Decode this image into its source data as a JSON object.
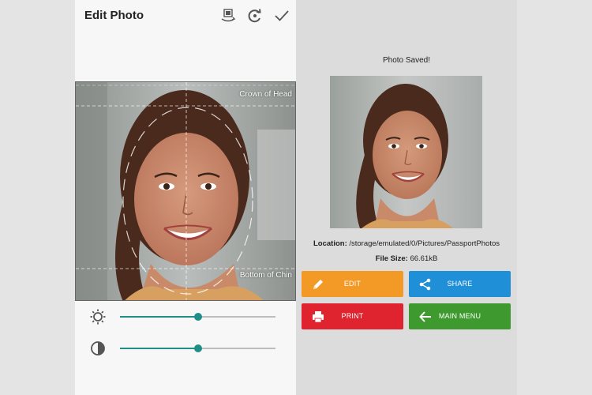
{
  "edit_screen": {
    "title": "Edit Photo",
    "toolbar_icons": [
      "crop-rotate-icon",
      "reset-icon",
      "check-icon"
    ],
    "guides": {
      "top_label": "Crown of Head",
      "bottom_label": "Bottom of Chin"
    },
    "sliders": [
      {
        "name": "brightness",
        "icon": "brightness-icon",
        "value": 0.5
      },
      {
        "name": "contrast",
        "icon": "contrast-icon",
        "value": 0.5
      }
    ]
  },
  "saved_screen": {
    "status": "Photo Saved!",
    "location_label": "Location:",
    "location_value": "/storage/emulated/0/Pictures/PassportPhotos",
    "filesize_label": "File Size:",
    "filesize_value": "66.61kB",
    "buttons": [
      {
        "label": "EDIT",
        "icon": "pencil-icon",
        "color": "#f39a26"
      },
      {
        "label": "SHARE",
        "icon": "share-icon",
        "color": "#1f8fd8"
      },
      {
        "label": "PRINT",
        "icon": "printer-icon",
        "color": "#e0242f"
      },
      {
        "label": "MAIN MENU",
        "icon": "arrow-left-icon",
        "color": "#3e9a2f"
      }
    ]
  },
  "colors": {
    "accent_teal": "#1e8f86",
    "side_background": "#e4e4e4",
    "right_background": "#dcdcdc"
  }
}
